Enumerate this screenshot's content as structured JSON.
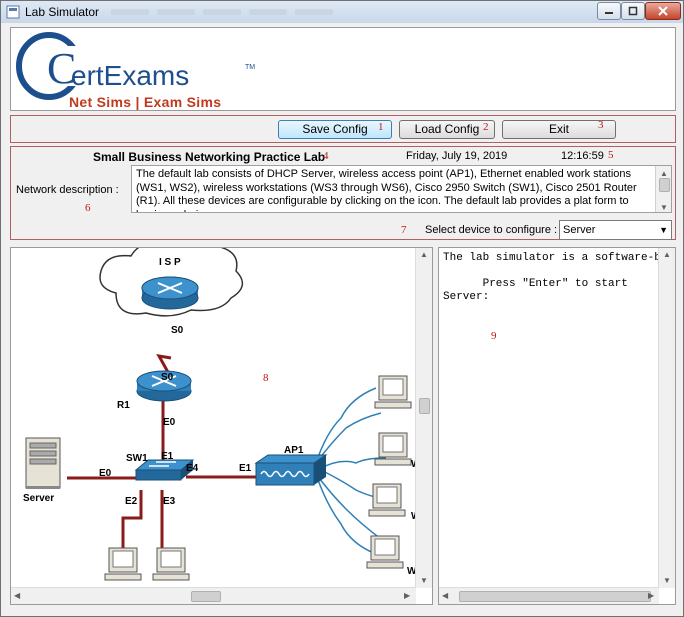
{
  "window": {
    "title": "Lab Simulator"
  },
  "logo": {
    "brand": "ertExams",
    "brand_initial": "C",
    "trademark": "TM",
    "tagline": "Net Sims | Exam Sims"
  },
  "toolbar": {
    "save_label": "Save Config",
    "load_label": "Load Config",
    "exit_label": "Exit"
  },
  "lab": {
    "title": "Small Business Networking Practice Lab",
    "date": "Friday, July 19, 2019",
    "time": "12:16:59",
    "description_label": "Network description :",
    "description": "The default lab consists of DHCP Server, wireless access point (AP1), Ethernet enabled work stations (WS1, WS2), wireless workstations (WS3 through WS6), Cisco 2950 Switch (SW1), Cisco 2501 Router (R1). All these devices are configurable by clicking on the icon. The default lab provides a plat form to begin exploring",
    "select_label": "Select device to configure :",
    "selected_device": "Server"
  },
  "markers": [
    "1",
    "2",
    "3",
    "4",
    "5",
    "6",
    "7",
    "8",
    "9"
  ],
  "diagram": {
    "isp_label": "I S P",
    "isp_port": "S0",
    "r1_serial": "S0",
    "r1_label": "R1",
    "r1_eth": "E0",
    "sw_label": "SW1",
    "sw_e1": "E1",
    "sw_e0": "E0",
    "sw_e2": "E2",
    "sw_e3": "E3",
    "sw_e4": "E4",
    "ap_e1": "E1",
    "ap_label": "AP1",
    "server_label": "Server",
    "ws_w1": "W",
    "ws_w2": "W",
    "ws_w3": "WS"
  },
  "console": {
    "line1": "The lab simulator is a software-ba",
    "line2": "",
    "line3": "      Press \"Enter\" to start",
    "line4": "Server:"
  },
  "colors": {
    "marker": "#c01818",
    "link": "#8b1a1a",
    "device": "#2f7fb8",
    "logo_blue": "#1c4f8c",
    "logo_red": "#c03a1e"
  }
}
